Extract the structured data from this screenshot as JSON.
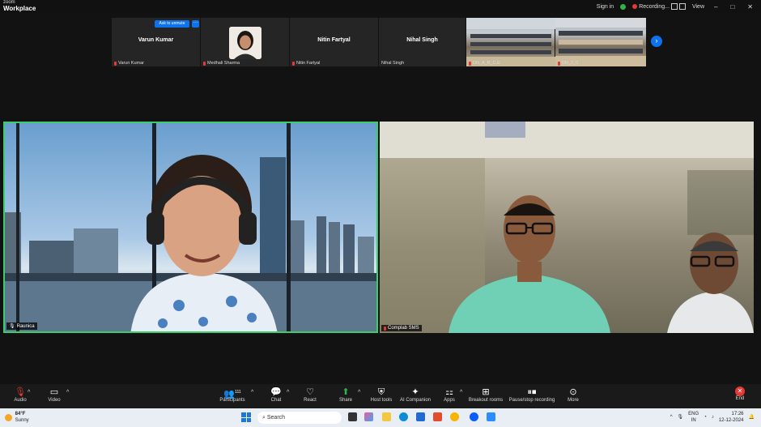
{
  "window": {
    "brand_small": "zoom",
    "brand_big": "Workplace",
    "sign_in": "Sign in",
    "recording": "Recording...",
    "view": "View",
    "minimize": "–",
    "maximize": "□",
    "close": "✕"
  },
  "strip": {
    "tiles": [
      {
        "name": "Varun Kumar",
        "label": "Varun Kumar",
        "muted": true
      },
      {
        "name": "",
        "label": "Medhali Sharma",
        "muted": true
      },
      {
        "name": "Nitin Fartyal",
        "label": "Nitin Fartyal",
        "muted": true
      },
      {
        "name": "Nihal Singh",
        "label": "Nihal Singh",
        "muted": false
      },
      {
        "name": "",
        "label": "DN_A_B_C.E",
        "muted": true
      },
      {
        "name": "",
        "label": "DN_2_0",
        "muted": true
      }
    ],
    "ask_to_unmute": "Ask to unmute",
    "more_dots": "···",
    "next_icon": "›"
  },
  "videos": [
    {
      "label": "Raunica",
      "active_speaker": true
    },
    {
      "label": "Complab SMS",
      "active_speaker": false
    }
  ],
  "toolbar": {
    "audio": "Audio",
    "video": "Video",
    "participants": "Participants",
    "participants_count": "111",
    "chat": "Chat",
    "react": "React",
    "share": "Share",
    "host_tools": "Host tools",
    "ai_companion": "AI Companion",
    "apps": "Apps",
    "breakout_rooms": "Breakout rooms",
    "pause_stop_recording": "Pause/stop recording",
    "more": "More",
    "end": "End"
  },
  "taskbar": {
    "weather_temp": "84°F",
    "weather_desc": "Sunny",
    "search_placeholder": "Search",
    "lang1": "ENG",
    "lang2": "IN",
    "time": "17:26",
    "date": "12-12-2024"
  },
  "colors": {
    "accent": "#0e72ed",
    "active_speaker": "#3ccc6b",
    "danger": "#e53935"
  }
}
